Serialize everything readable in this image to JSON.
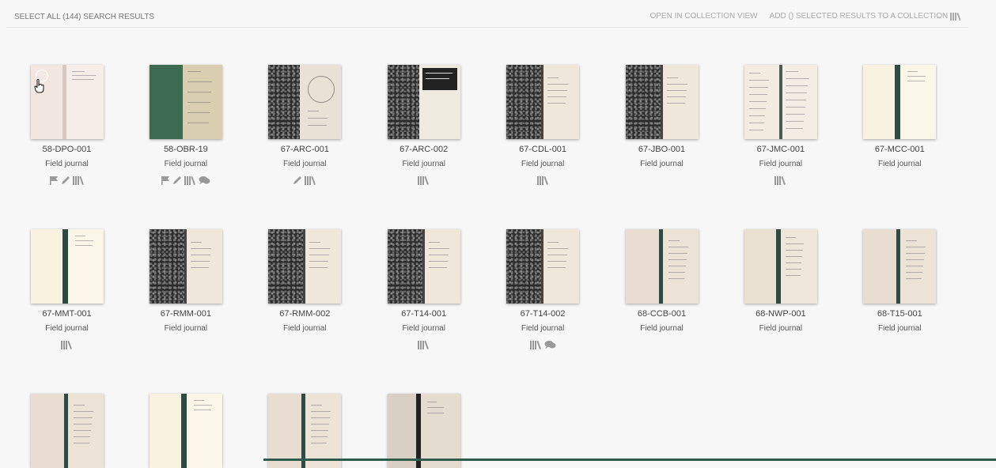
{
  "toolbar": {
    "select_all": "SELECT ALL (144) SEARCH RESULTS",
    "open_collection": "OPEN IN COLLECTION VIEW",
    "add_selected": "ADD () SELECTED RESULTS TO A COLLECTION"
  },
  "colors": {
    "selection": "#3aa7c4",
    "marble": "#2b2b2b",
    "spine": "#2e4a44",
    "page": "#f4ead8"
  },
  "results": [
    {
      "id": "58-DPO-001",
      "type": "Field journal",
      "icons": [
        "flag-icon",
        "pencil-icon",
        "library-icon"
      ],
      "style": "open-pink",
      "selected": true
    },
    {
      "id": "58-OBR-19",
      "type": "Field journal",
      "icons": [
        "flag-icon",
        "pencil-icon",
        "library-icon",
        "comment-icon"
      ],
      "style": "green-cover"
    },
    {
      "id": "67-ARC-001",
      "type": "Field journal",
      "icons": [
        "pencil-icon",
        "library-icon"
      ],
      "style": "marble-drawing"
    },
    {
      "id": "67-ARC-002",
      "type": "Field journal",
      "icons": [
        "library-icon"
      ],
      "style": "marble-label"
    },
    {
      "id": "67-CDL-001",
      "type": "Field journal",
      "icons": [
        "library-icon"
      ],
      "style": "marble-note"
    },
    {
      "id": "67-JBO-001",
      "type": "Field journal",
      "icons": [],
      "style": "marble-note"
    },
    {
      "id": "67-JMC-001",
      "type": "Field journal",
      "icons": [
        "library-icon"
      ],
      "style": "open-lined"
    },
    {
      "id": "67-MCC-001",
      "type": "Field journal",
      "icons": [],
      "style": "open-cream"
    },
    {
      "id": "67-MMT-001",
      "type": "Field journal",
      "icons": [
        "library-icon"
      ],
      "style": "open-cream"
    },
    {
      "id": "67-RMM-001",
      "type": "Field journal",
      "icons": [],
      "style": "marble-note"
    },
    {
      "id": "67-RMM-002",
      "type": "Field journal",
      "icons": [],
      "style": "marble-note"
    },
    {
      "id": "67-T14-001",
      "type": "Field journal",
      "icons": [
        "library-icon"
      ],
      "style": "marble-note"
    },
    {
      "id": "67-T14-002",
      "type": "Field journal",
      "icons": [
        "library-icon",
        "comment-icon"
      ],
      "style": "marble-note"
    },
    {
      "id": "68-CCB-001",
      "type": "Field journal",
      "icons": [],
      "style": "open-tan"
    },
    {
      "id": "68-NWP-001",
      "type": "Field journal",
      "icons": [],
      "style": "open-tan-lined"
    },
    {
      "id": "68-T15-001",
      "type": "Field journal",
      "icons": [],
      "style": "open-tan"
    },
    {
      "style": "open-tan"
    },
    {
      "style": "open-cream"
    },
    {
      "style": "open-tan"
    },
    {
      "style": "open-dark-spine"
    }
  ]
}
